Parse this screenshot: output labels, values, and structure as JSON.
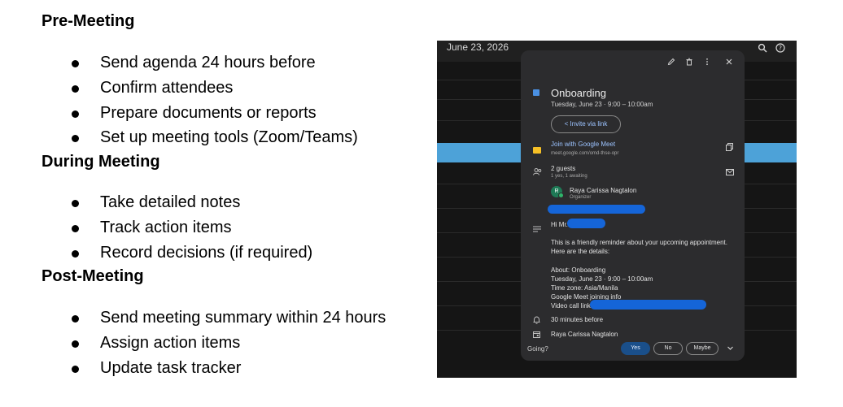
{
  "document": {
    "sections": [
      {
        "heading": "Pre-Meeting",
        "items": [
          "Send agenda 24 hours before",
          "Confirm attendees",
          "Prepare documents or reports",
          "Set up meeting tools (Zoom/Teams)"
        ]
      },
      {
        "heading": "During Meeting",
        "items": [
          "Take detailed notes",
          "Track action items",
          "Record decisions (if required)"
        ]
      },
      {
        "heading": "Post-Meeting",
        "items": [
          "Send meeting summary within 24 hours",
          "Assign action items",
          "Update task tracker"
        ]
      }
    ]
  },
  "calendar": {
    "date": "June 23, 2026",
    "header_icons": [
      "search-icon",
      "help-icon"
    ],
    "event": {
      "toolbar_icons": [
        "edit-icon",
        "delete-icon",
        "more-icon",
        "close-icon"
      ],
      "color": "#4a90e2",
      "title": "Onboarding",
      "time": "Tuesday, June 23  ·  9:00 – 10:00am",
      "invite_label": "Invite via link",
      "meet": {
        "label": "Join with Google Meet",
        "url": "meet.google.com/omd-thse-opr"
      },
      "guests": {
        "count_label": "2 guests",
        "summary": "1 yes, 1 awaiting",
        "organizer_initial": "R",
        "organizer_name": "Raya Carissa Nagtalon",
        "organizer_role": "Organizer"
      },
      "description": {
        "greeting": "Hi Mr.",
        "lines": [
          "This is a friendly reminder about your upcoming appointment.",
          "Here are the details:"
        ],
        "details": [
          "About:  Onboarding",
          "Tuesday, June 23 · 9:00 – 10:00am",
          "Time zone: Asia/Manila",
          "Google Meet joining info",
          "Video call link:"
        ]
      },
      "reminder": "30 minutes before",
      "calendar_owner": "Raya Carissa Nagtalon",
      "rsvp": {
        "label": "Going?",
        "yes": "Yes",
        "no": "No",
        "maybe": "Maybe"
      }
    }
  }
}
